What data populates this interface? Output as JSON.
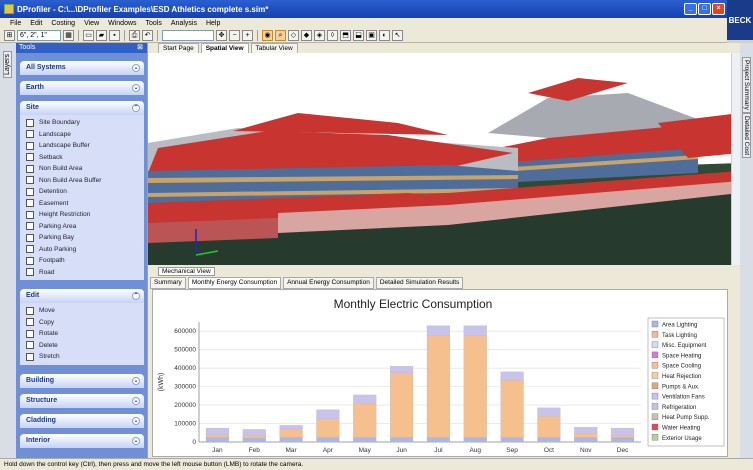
{
  "window": {
    "title": "DProfiler - C:\\...\\DProfiler Examples\\ESD Athletics complete s.sim*",
    "brand": "BECK"
  },
  "menu": [
    "File",
    "Edit",
    "Costing",
    "View",
    "Windows",
    "Tools",
    "Analysis",
    "Help"
  ],
  "toolbar": {
    "grid_value": "6\", 2\", 1\"",
    "view_combo": ""
  },
  "left_tab": "Layers",
  "tools_panel": {
    "title": "Tools",
    "sections": {
      "all_systems": "All Systems",
      "earth": "Earth",
      "site": "Site",
      "edit": "Edit",
      "building": "Building",
      "structure": "Structure",
      "cladding": "Cladding",
      "interior": "Interior"
    },
    "site_items": [
      "Site Boundary",
      "Landscape",
      "Landscape Buffer",
      "Setback",
      "Non Build Area",
      "Non Build Area Buffer",
      "Detention",
      "Easement",
      "Height Restriction",
      "Parking Area",
      "Parking Bay",
      "Auto Parking",
      "Footpath",
      "Road"
    ],
    "edit_items": [
      "Move",
      "Copy",
      "Rotate",
      "Delete",
      "Stretch"
    ]
  },
  "doc_tabs": [
    "Start Page",
    "Spatial View",
    "Tabular View"
  ],
  "bottom": {
    "mechanical_tab": "Mechanical View",
    "tabs": [
      "Summary",
      "Monthly Energy Consumption",
      "Annual Energy Consumption",
      "Detailed Simulation Results"
    ]
  },
  "right_tabs": [
    "Project Summary",
    "Detailed Cost"
  ],
  "status": "Hold down the control key (Ctrl), then press and move the left mouse button (LMB) to rotate the camera.",
  "chart_data": {
    "type": "bar",
    "title": "Monthly Electric Consumption",
    "ylabel": "(kWh)",
    "ylim": [
      0,
      650000
    ],
    "yticks": [
      "0",
      "100000",
      "200000",
      "300000",
      "400000",
      "500000",
      "600000"
    ],
    "categories": [
      "Jan",
      "Feb",
      "Mar",
      "Apr",
      "May",
      "Jun",
      "Jul",
      "Aug",
      "Sep",
      "Oct",
      "Nov",
      "Dec"
    ],
    "legend": [
      "Area Lighting",
      "Task Lighting",
      "Misc. Equipment",
      "Space Heating",
      "Space Cooling",
      "Heat Rejection",
      "Pumps & Aux.",
      "Ventilation Fans",
      "Refrigeration",
      "Heat Pump Supp.",
      "Water Heating",
      "Exterior Usage"
    ],
    "legend_colors": [
      "#a9b8e8",
      "#f4b79c",
      "#d6d9f4",
      "#d47ad0",
      "#f6c08e",
      "#f3cf9a",
      "#e5a77a",
      "#c7c3ea",
      "#bfc7dc",
      "#c8c0b8",
      "#e44a4a",
      "#a9d59a"
    ],
    "series": [
      {
        "name": "Area Lighting",
        "values": [
          25000,
          22000,
          25000,
          25000,
          25000,
          25000,
          25000,
          25000,
          25000,
          25000,
          25000,
          25000
        ]
      },
      {
        "name": "Space Cooling",
        "values": [
          15000,
          12000,
          45000,
          100000,
          185000,
          350000,
          550000,
          550000,
          310000,
          115000,
          20000,
          10000
        ]
      },
      {
        "name": "Ventilation Fans",
        "values": [
          35000,
          34000,
          20000,
          50000,
          45000,
          35000,
          55000,
          55000,
          45000,
          45000,
          35000,
          40000
        ]
      }
    ],
    "series_colors": [
      "#a9b8e8",
      "#f6c08e",
      "#c7c3ea"
    ]
  }
}
